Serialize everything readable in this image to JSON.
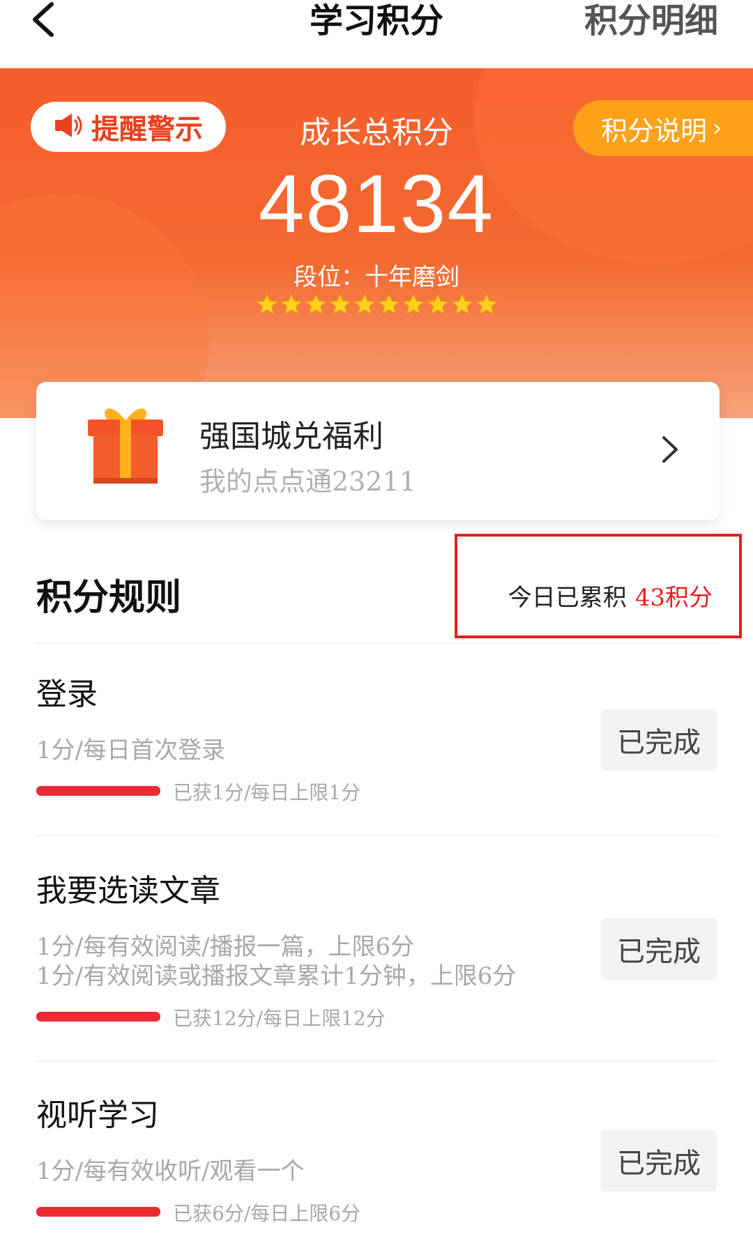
{
  "header": {
    "title": "学习积分",
    "detail_link": "积分明细"
  },
  "hero": {
    "warning_label": "提醒警示",
    "caption": "成长总积分",
    "explain_label": "积分说明",
    "total_score": "48134",
    "rank": "段位：十年磨剑",
    "stars": 10
  },
  "gift": {
    "title": "强国城兑福利",
    "subtitle": "我的点点通23211"
  },
  "rules": {
    "title": "积分规则",
    "today_label": "今日已累积",
    "today_value": "43积分"
  },
  "tasks": [
    {
      "name": "登录",
      "desc": [
        "1分/每日首次登录"
      ],
      "progress_text": "已获1分/每日上限1分",
      "progress": 1.0,
      "button": "已完成"
    },
    {
      "name": "我要选读文章",
      "desc": [
        "1分/每有效阅读/播报一篇，上限6分",
        "1分/有效阅读或播报文章累计1分钟，上限6分"
      ],
      "progress_text": "已获12分/每日上限12分",
      "progress": 1.0,
      "button": "已完成"
    },
    {
      "name": "视听学习",
      "desc": [
        "1分/每有效收听/观看一个"
      ],
      "progress_text": "已获6分/每日上限6分",
      "progress": 1.0,
      "button": "已完成"
    }
  ],
  "colors": {
    "accent_red": "#e62020",
    "hero_orange": "#f45d2c",
    "pill_orange": "#ffa21a"
  }
}
